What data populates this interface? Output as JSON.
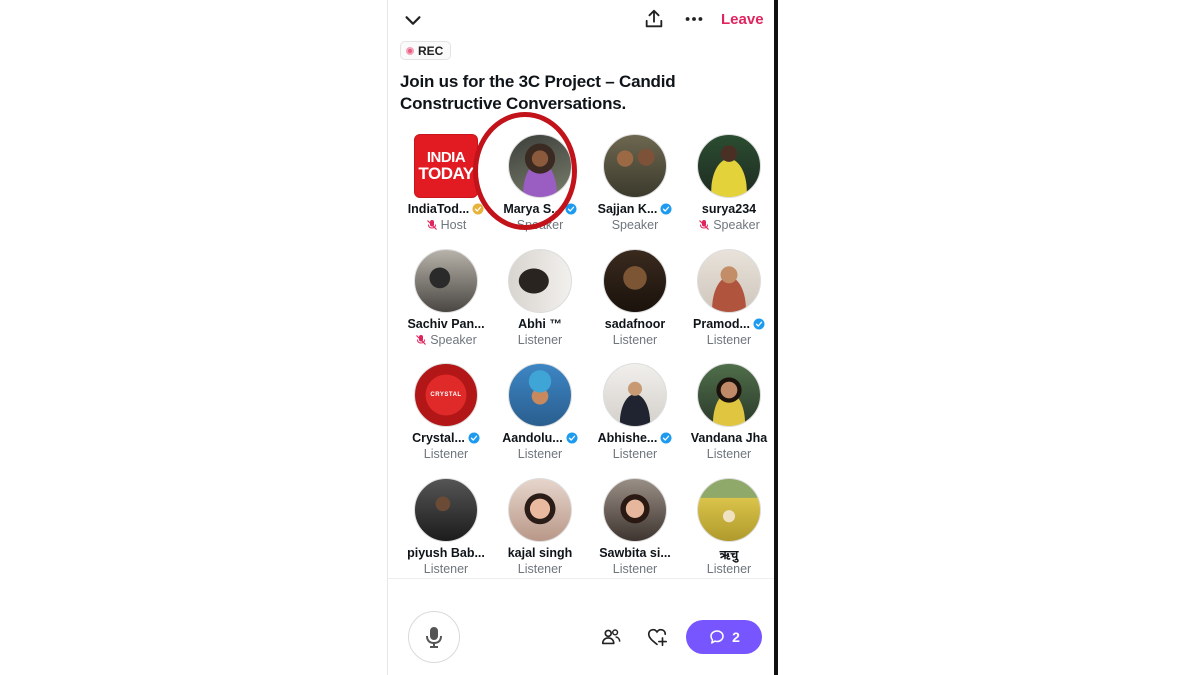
{
  "header": {
    "collapse_icon": "chevron-down-icon",
    "share_icon": "share-icon",
    "more_icon": "more-icon",
    "leave_label": "Leave"
  },
  "rec_badge": "REC",
  "space_title": "Join us for the 3C Project – Candid Constructive Conversations.",
  "participants": [
    {
      "name": "IndiaTod...",
      "badge": "gold",
      "role": "Host",
      "muted": true,
      "logo_text": [
        "INDIA",
        "TODAY"
      ]
    },
    {
      "name": "Marya S...",
      "badge": "blue",
      "role": "Speaker",
      "muted": false
    },
    {
      "name": "Sajjan K...",
      "badge": "blue",
      "role": "Speaker",
      "muted": false
    },
    {
      "name": "surya234",
      "badge": "",
      "role": "Speaker",
      "muted": true
    },
    {
      "name": "Sachiv Pan...",
      "badge": "",
      "role": "Speaker",
      "muted": true
    },
    {
      "name": "Abhi ™",
      "badge": "",
      "role": "Listener",
      "muted": false
    },
    {
      "name": "sadafnoor",
      "badge": "",
      "role": "Listener",
      "muted": false
    },
    {
      "name": "Pramod...",
      "badge": "blue",
      "role": "Listener",
      "muted": false
    },
    {
      "name": "Crystal...",
      "badge": "blue",
      "role": "Listener",
      "muted": false,
      "logo_text": [
        "CRYSTAL"
      ]
    },
    {
      "name": "Aandolu...",
      "badge": "blue",
      "role": "Listener",
      "muted": false
    },
    {
      "name": "Abhishe...",
      "badge": "blue",
      "role": "Listener",
      "muted": false
    },
    {
      "name": "Vandana Jha",
      "badge": "",
      "role": "Listener",
      "muted": false
    },
    {
      "name": "piyush Bab...",
      "badge": "",
      "role": "Listener",
      "muted": false
    },
    {
      "name": "kajal singh",
      "badge": "",
      "role": "Listener",
      "muted": false
    },
    {
      "name": "Sawbita si...",
      "badge": "",
      "role": "Listener",
      "muted": false
    },
    {
      "name": "ऋचु",
      "badge": "",
      "role": "Listener",
      "muted": false
    }
  ],
  "footer": {
    "mic_icon": "microphone-icon",
    "people_icon": "people-icon",
    "reaction_icon": "heart-plus-icon",
    "comment_icon": "comment-icon",
    "comment_count": "2"
  },
  "colors": {
    "leave": "#e0245e",
    "accent": "#7856ff",
    "verified_blue": "#1d9bf0",
    "verified_gold": "#e8b33a",
    "highlight_ring": "#c2121a"
  }
}
